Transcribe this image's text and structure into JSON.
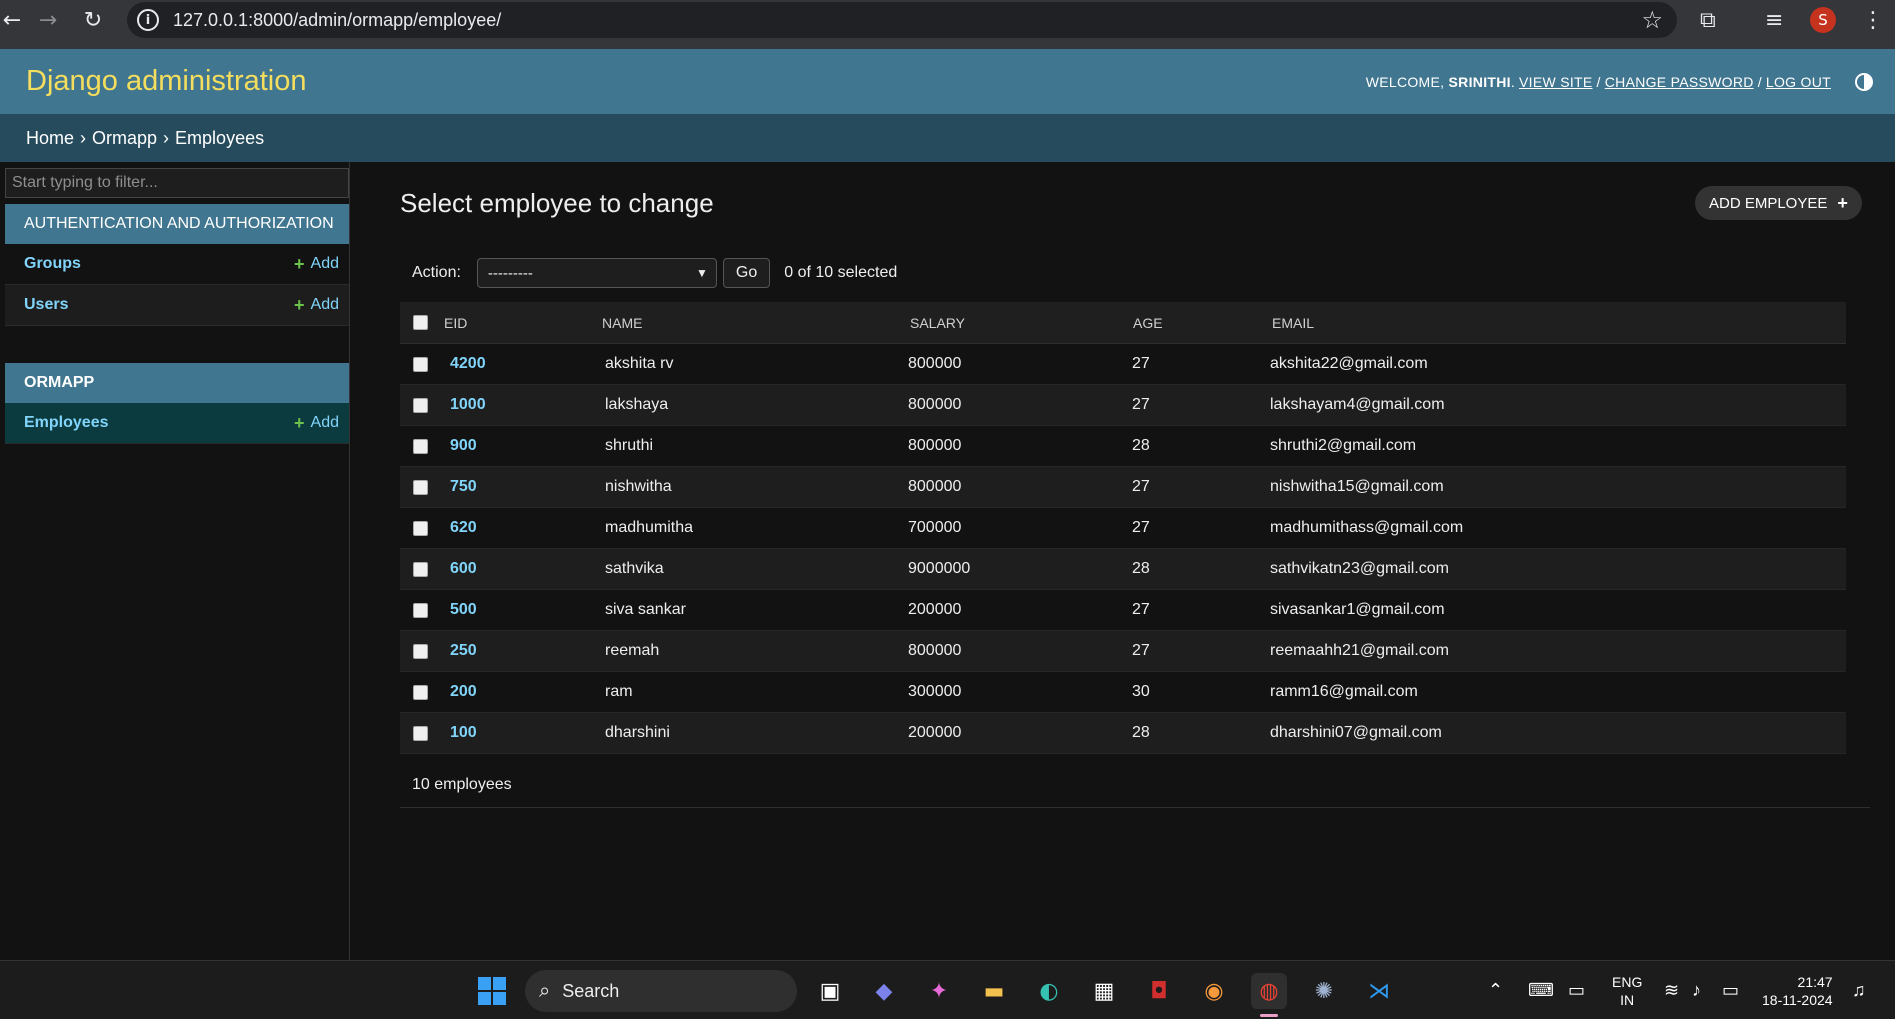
{
  "browser": {
    "url": "127.0.0.1:8000/admin/ormapp/employee/",
    "profile_initial": "S"
  },
  "header": {
    "brand": "Django administration",
    "welcome": "WELCOME,",
    "username": "SRINITHI",
    "view_site": "VIEW SITE",
    "change_password": "CHANGE PASSWORD",
    "log_out": "LOG OUT",
    "sep": "/"
  },
  "breadcrumbs": {
    "home": "Home",
    "app": "Ormapp",
    "current": "Employees",
    "sep": "›"
  },
  "sidebar": {
    "filter_placeholder": "Start typing to filter...",
    "modules": [
      {
        "caption": "AUTHENTICATION AND AUTHORIZATION",
        "models": [
          {
            "name": "Groups",
            "add": "Add"
          },
          {
            "name": "Users",
            "add": "Add"
          }
        ]
      },
      {
        "caption": "ORMAPP",
        "models": [
          {
            "name": "Employees",
            "add": "Add"
          }
        ]
      }
    ]
  },
  "main": {
    "title": "Select employee to change",
    "add_button": "ADD EMPLOYEE",
    "action_label": "Action:",
    "action_selected": "---------",
    "go": "Go",
    "counter": "0 of 10 selected",
    "columns": [
      "EID",
      "NAME",
      "SALARY",
      "AGE",
      "EMAIL"
    ],
    "rows": [
      {
        "eid": "4200",
        "name": "akshita rv",
        "salary": "800000",
        "age": "27",
        "email": "akshita22@gmail.com"
      },
      {
        "eid": "1000",
        "name": "lakshaya",
        "salary": "800000",
        "age": "27",
        "email": "lakshayam4@gmail.com"
      },
      {
        "eid": "900",
        "name": "shruthi",
        "salary": "800000",
        "age": "28",
        "email": "shruthi2@gmail.com"
      },
      {
        "eid": "750",
        "name": "nishwitha",
        "salary": "800000",
        "age": "27",
        "email": "nishwitha15@gmail.com"
      },
      {
        "eid": "620",
        "name": "madhumitha",
        "salary": "700000",
        "age": "27",
        "email": "madhumithass@gmail.com"
      },
      {
        "eid": "600",
        "name": "sathvika",
        "salary": "9000000",
        "age": "28",
        "email": "sathvikatn23@gmail.com"
      },
      {
        "eid": "500",
        "name": "siva sankar",
        "salary": "200000",
        "age": "27",
        "email": "sivasankar1@gmail.com"
      },
      {
        "eid": "250",
        "name": "reemah",
        "salary": "800000",
        "age": "27",
        "email": "reemaahh21@gmail.com"
      },
      {
        "eid": "200",
        "name": "ram",
        "salary": "300000",
        "age": "30",
        "email": "ramm16@gmail.com"
      },
      {
        "eid": "100",
        "name": "dharshini",
        "salary": "200000",
        "age": "28",
        "email": "dharshini07@gmail.com"
      }
    ],
    "result_count": "10 employees"
  },
  "taskbar": {
    "search": "Search",
    "lang_line1": "ENG",
    "lang_line2": "IN",
    "time": "21:47",
    "date": "18-11-2024"
  },
  "colors": {
    "header_bg": "#417690",
    "brand": "#f5dd5d",
    "breadcrumb_bg": "#264b5d",
    "link": "#81d4fa",
    "add_plus": "#6dc24b"
  }
}
